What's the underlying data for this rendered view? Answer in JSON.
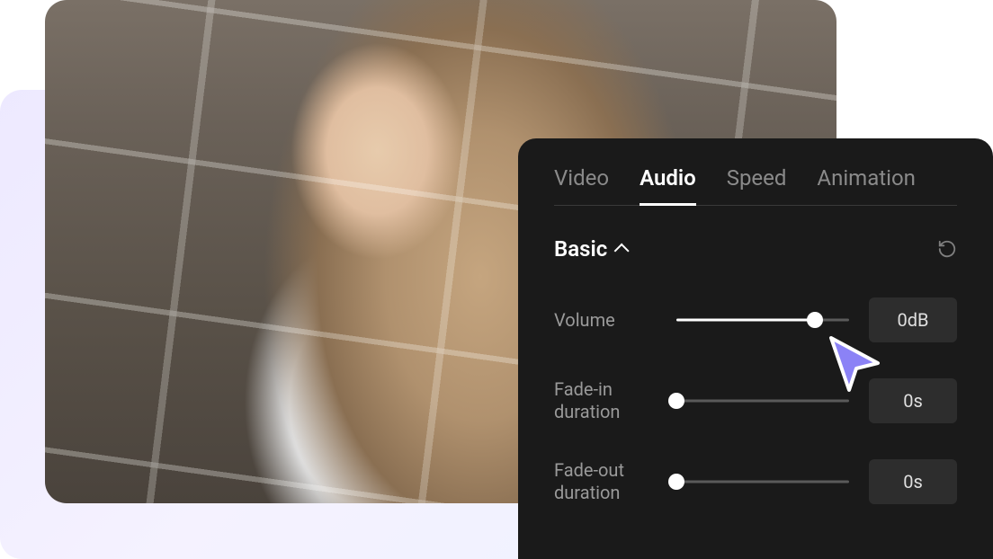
{
  "tabs": {
    "video": "Video",
    "audio": "Audio",
    "speed": "Speed",
    "animation": "Animation",
    "active": "audio"
  },
  "section": {
    "title": "Basic"
  },
  "controls": {
    "volume": {
      "label": "Volume",
      "value": "0dB",
      "position": 80
    },
    "fadeIn": {
      "label": "Fade-in duration",
      "value": "0s",
      "position": 0
    },
    "fadeOut": {
      "label": "Fade-out duration",
      "value": "0s",
      "position": 0
    }
  },
  "colors": {
    "panel": "#1a1a1a",
    "cursor": "#8b82f6"
  }
}
